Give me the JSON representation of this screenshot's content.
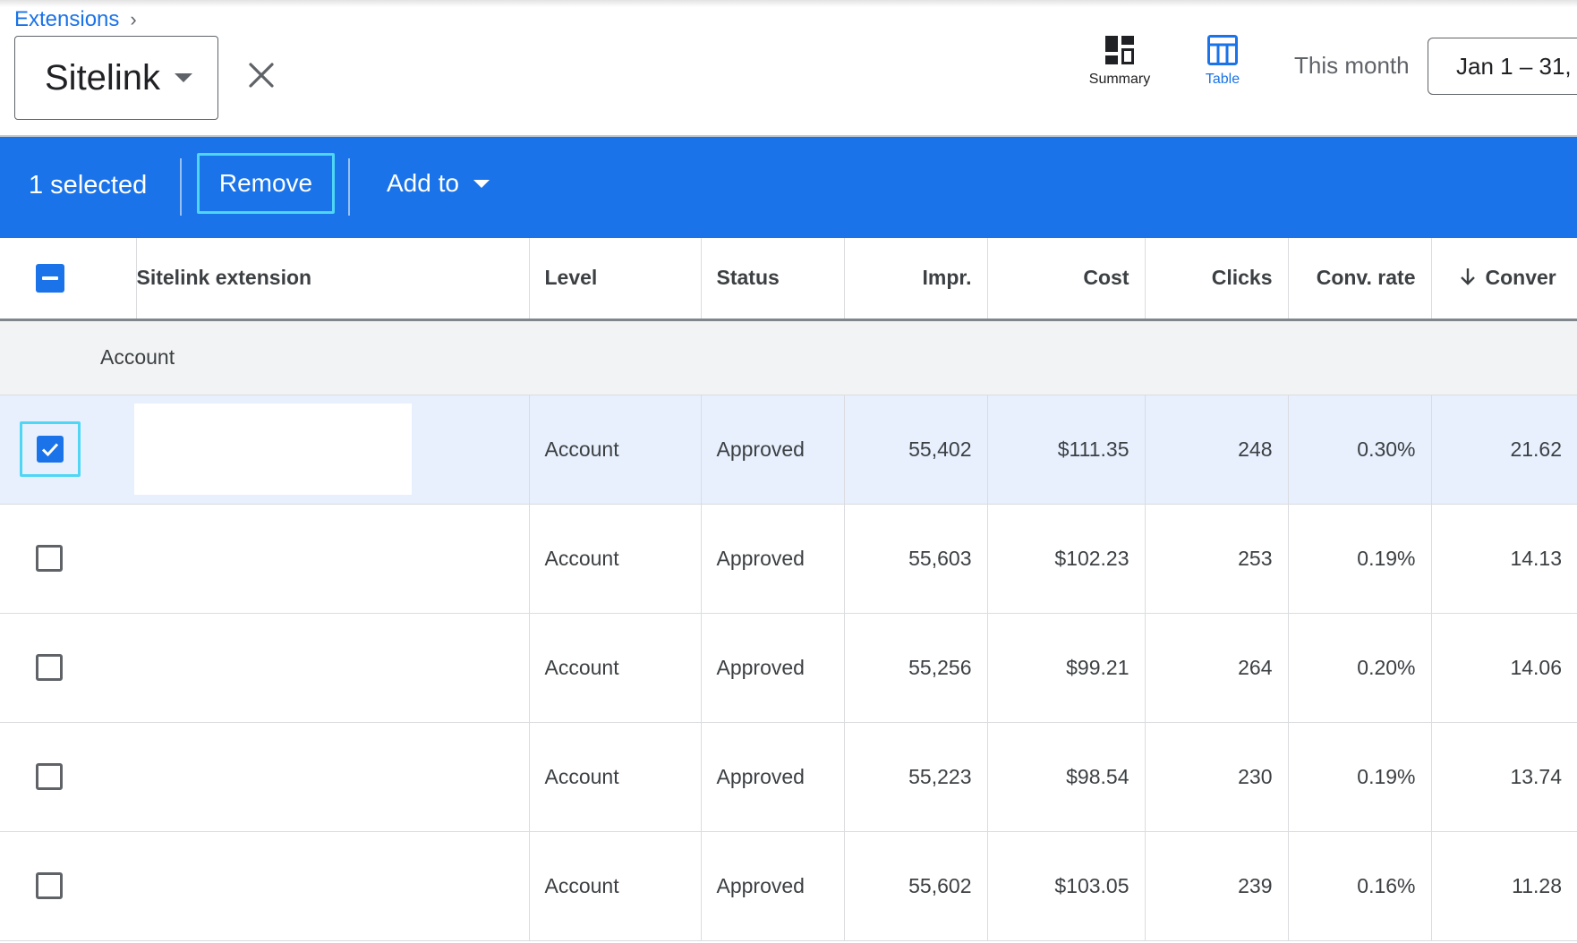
{
  "breadcrumb": {
    "parent": "Extensions"
  },
  "picker": {
    "label": "Sitelink"
  },
  "views": {
    "summary": "Summary",
    "table": "Table"
  },
  "period": {
    "label": "This month",
    "range": "Jan 1 – 31,"
  },
  "colors": {
    "accent": "#1a73e8",
    "focus": "#4fd6f5",
    "selected_row": "#e8f0fe",
    "group_row": "#f1f3f4"
  },
  "action_bar": {
    "selected": "1 selected",
    "remove": "Remove",
    "add_to": "Add to"
  },
  "table": {
    "headers": {
      "extension": "Sitelink extension",
      "level": "Level",
      "status": "Status",
      "impr": "Impr.",
      "cost": "Cost",
      "clicks": "Clicks",
      "conv_rate": "Conv. rate",
      "conversions": "Conver"
    },
    "group": "Account",
    "rows": [
      {
        "level": "Account",
        "status": "Approved",
        "impr": "55,402",
        "cost": "$111.35",
        "clicks": "248",
        "conv_rate": "0.30%",
        "conversions": "21.62",
        "selected": true
      },
      {
        "level": "Account",
        "status": "Approved",
        "impr": "55,603",
        "cost": "$102.23",
        "clicks": "253",
        "conv_rate": "0.19%",
        "conversions": "14.13",
        "selected": false
      },
      {
        "level": "Account",
        "status": "Approved",
        "impr": "55,256",
        "cost": "$99.21",
        "clicks": "264",
        "conv_rate": "0.20%",
        "conversions": "14.06",
        "selected": false
      },
      {
        "level": "Account",
        "status": "Approved",
        "impr": "55,223",
        "cost": "$98.54",
        "clicks": "230",
        "conv_rate": "0.19%",
        "conversions": "13.74",
        "selected": false
      },
      {
        "level": "Account",
        "status": "Approved",
        "impr": "55,602",
        "cost": "$103.05",
        "clicks": "239",
        "conv_rate": "0.16%",
        "conversions": "11.28",
        "selected": false
      }
    ]
  },
  "icons": {
    "breadcrumb": "chevron-right-icon",
    "close": "close-icon",
    "summary": "dashboard-icon",
    "table": "table-icon",
    "sort": "arrow-down-icon",
    "checkbox": "checkbox-icon"
  }
}
